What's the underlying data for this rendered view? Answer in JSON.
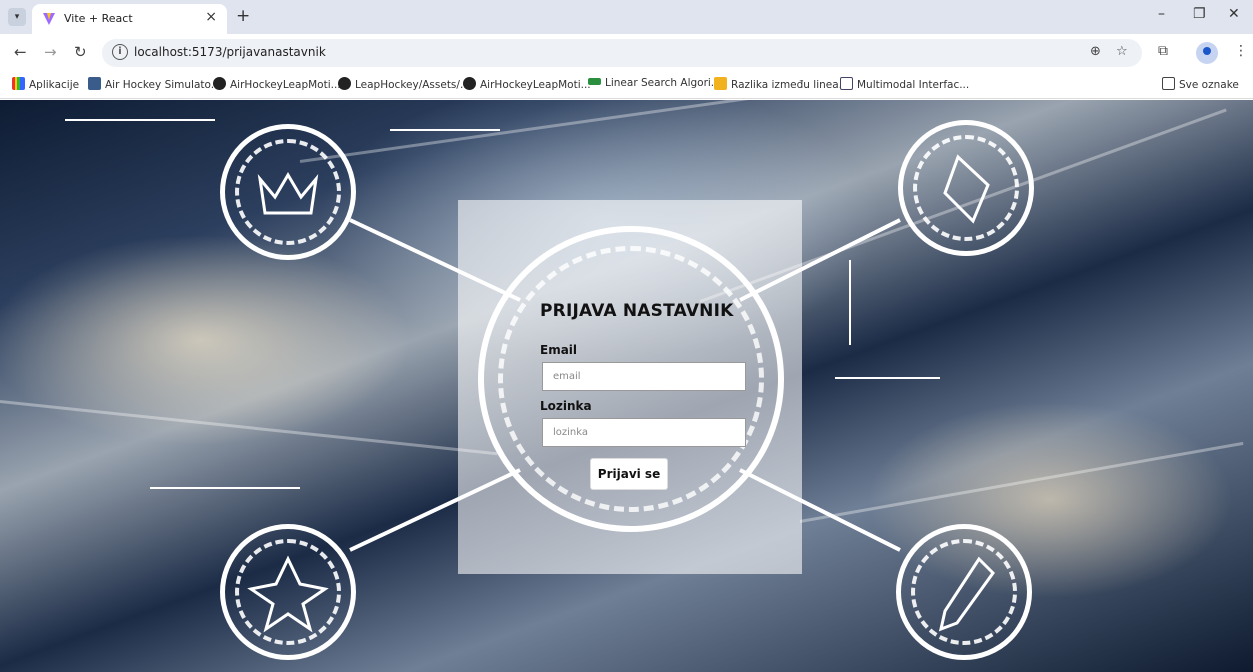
{
  "browser": {
    "tab_title": "Vite + React",
    "tab_close": "×",
    "new_tab": "+",
    "url": "localhost:5173/prijavanastavnik",
    "minimize": "–",
    "maximize": "❐",
    "close": "✕"
  },
  "bookmarks": [
    {
      "label": "Aplikacije",
      "icon": "apps-grid-icon"
    },
    {
      "label": "Air Hockey Simulato...",
      "icon": "site-icon"
    },
    {
      "label": "AirHockeyLeapMoti...",
      "icon": "github-icon"
    },
    {
      "label": "LeapHockey/Assets/...",
      "icon": "github-icon"
    },
    {
      "label": "AirHockeyLeapMoti...",
      "icon": "github-icon"
    },
    {
      "label": "Linear Search Algori...",
      "icon": "site-icon"
    },
    {
      "label": "Razlika između linea...",
      "icon": "site-icon"
    },
    {
      "label": "Multimodal Interfac...",
      "icon": "site-icon"
    }
  ],
  "all_bookmarks": "Sve oznake",
  "login": {
    "title": "PRIJAVA NASTAVNIK",
    "email_label": "Email",
    "email_placeholder": "email",
    "password_label": "Lozinka",
    "password_placeholder": "lozinka",
    "submit_label": "Prijavi se"
  },
  "colors": {
    "tabstrip": "#dfe4ee",
    "accent": "#1a57c9"
  }
}
